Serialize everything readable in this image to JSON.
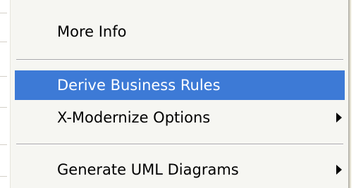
{
  "context_menu": {
    "items": [
      {
        "label": "More Info",
        "has_submenu": false,
        "highlighted": false
      },
      {
        "label": "Derive Business Rules",
        "has_submenu": false,
        "highlighted": true
      },
      {
        "label": "X-Modernize Options",
        "has_submenu": true,
        "highlighted": false
      },
      {
        "label": "Generate UML Diagrams",
        "has_submenu": true,
        "highlighted": false
      }
    ],
    "colors": {
      "menu_background": "#f6f6f2",
      "highlight": "#3d7ad6",
      "highlight_text": "#ffffff",
      "text": "#000000",
      "separator": "#a7a6aa"
    },
    "icons": {
      "submenu": "chevron-right-icon"
    }
  }
}
